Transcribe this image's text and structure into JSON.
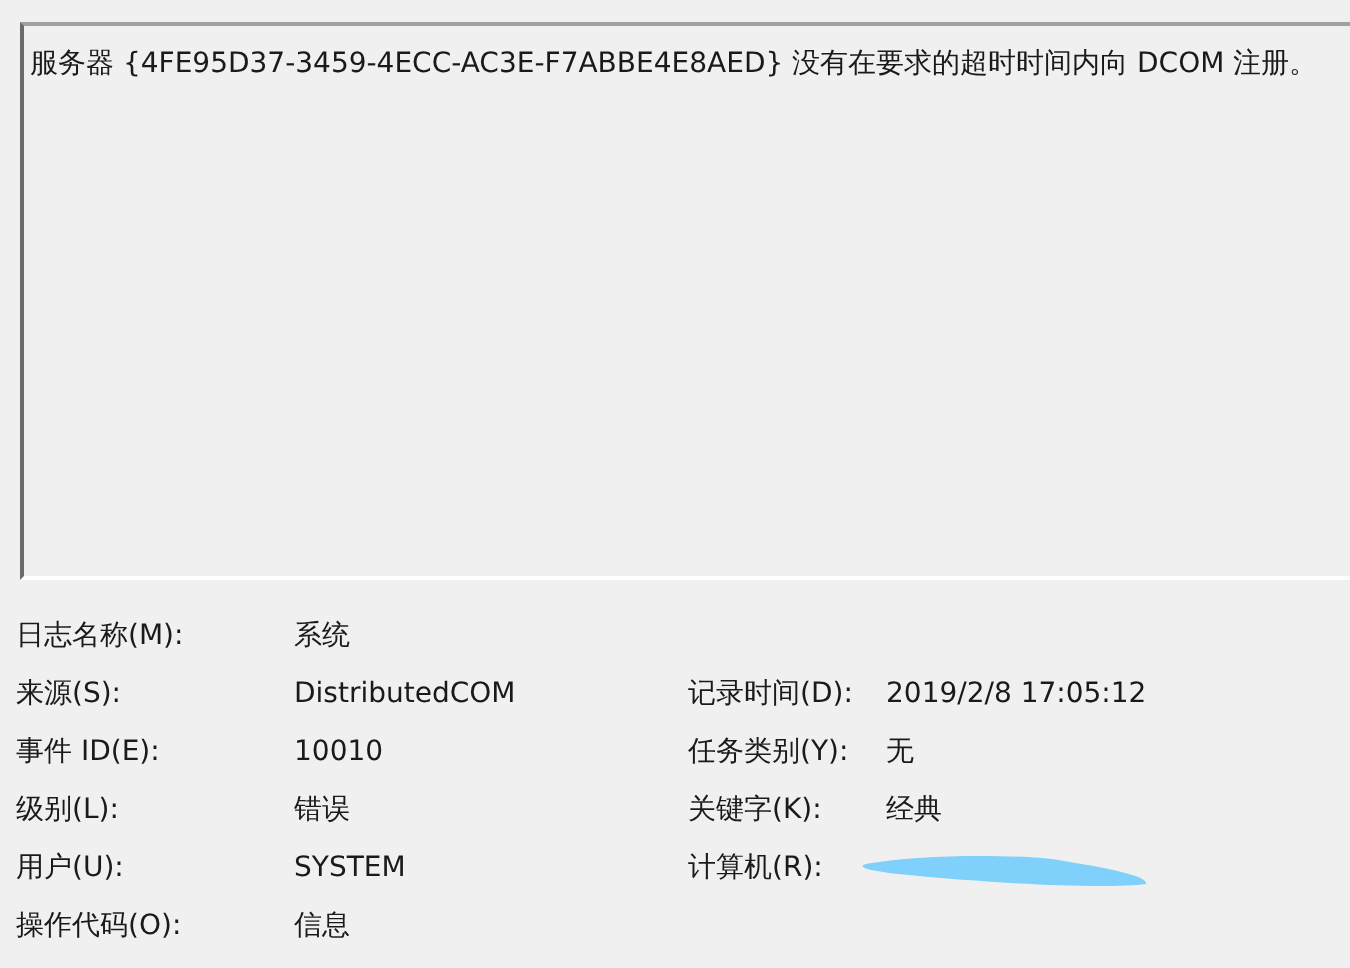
{
  "description": "服务器 {4FE95D37-3459-4ECC-AC3E-F7ABBE4E8AED} 没有在要求的超时时间内向 DCOM 注册。",
  "rows": [
    {
      "left": {
        "label": "日志名称(M):",
        "value": "系统"
      }
    },
    {
      "left": {
        "label": "来源(S):",
        "value": "DistributedCOM"
      },
      "right": {
        "label": "记录时间(D):",
        "value": "2019/2/8 17:05:12"
      }
    },
    {
      "left": {
        "label": "事件 ID(E):",
        "value": "10010"
      },
      "right": {
        "label": "任务类别(Y):",
        "value": "无"
      }
    },
    {
      "left": {
        "label": "级别(L):",
        "value": "错误"
      },
      "right": {
        "label": "关键字(K):",
        "value": "经典"
      }
    },
    {
      "left": {
        "label": "用户(U):",
        "value": "SYSTEM"
      },
      "right": {
        "label": "计算机(R):",
        "redacted": true
      }
    },
    {
      "left": {
        "label": "操作代码(O):",
        "value": "信息"
      }
    }
  ]
}
